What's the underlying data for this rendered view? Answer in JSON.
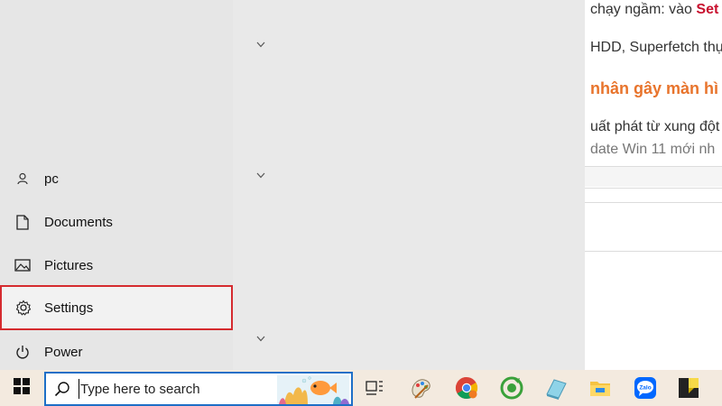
{
  "background_page": {
    "lines": [
      {
        "text": "chạy ngầm: vào ",
        "emph": "Set"
      },
      {
        "text": "HDD, Superfetch thực"
      },
      {
        "text": "nhân gây màn hì"
      },
      {
        "text": "uất phát từ xung đột"
      },
      {
        "text": "date Win 11 mới nh"
      }
    ]
  },
  "start_menu": {
    "items": [
      {
        "label": "pc",
        "icon": "user-icon"
      },
      {
        "label": "Documents",
        "icon": "document-icon"
      },
      {
        "label": "Pictures",
        "icon": "picture-icon"
      },
      {
        "label": "Settings",
        "icon": "gear-icon"
      },
      {
        "label": "Power",
        "icon": "power-icon"
      }
    ],
    "highlight_color": "#d52b2f"
  },
  "taskbar": {
    "search_placeholder": "Type here to search",
    "accent": "#1e6fc7",
    "icons": [
      "task-view-icon",
      "paint-icon",
      "chrome-icon",
      "coccoc-icon",
      "app-icon",
      "file-explorer-icon",
      "zalo-icon",
      "sticky-notes-icon"
    ],
    "zalo_label": "Zalo"
  }
}
